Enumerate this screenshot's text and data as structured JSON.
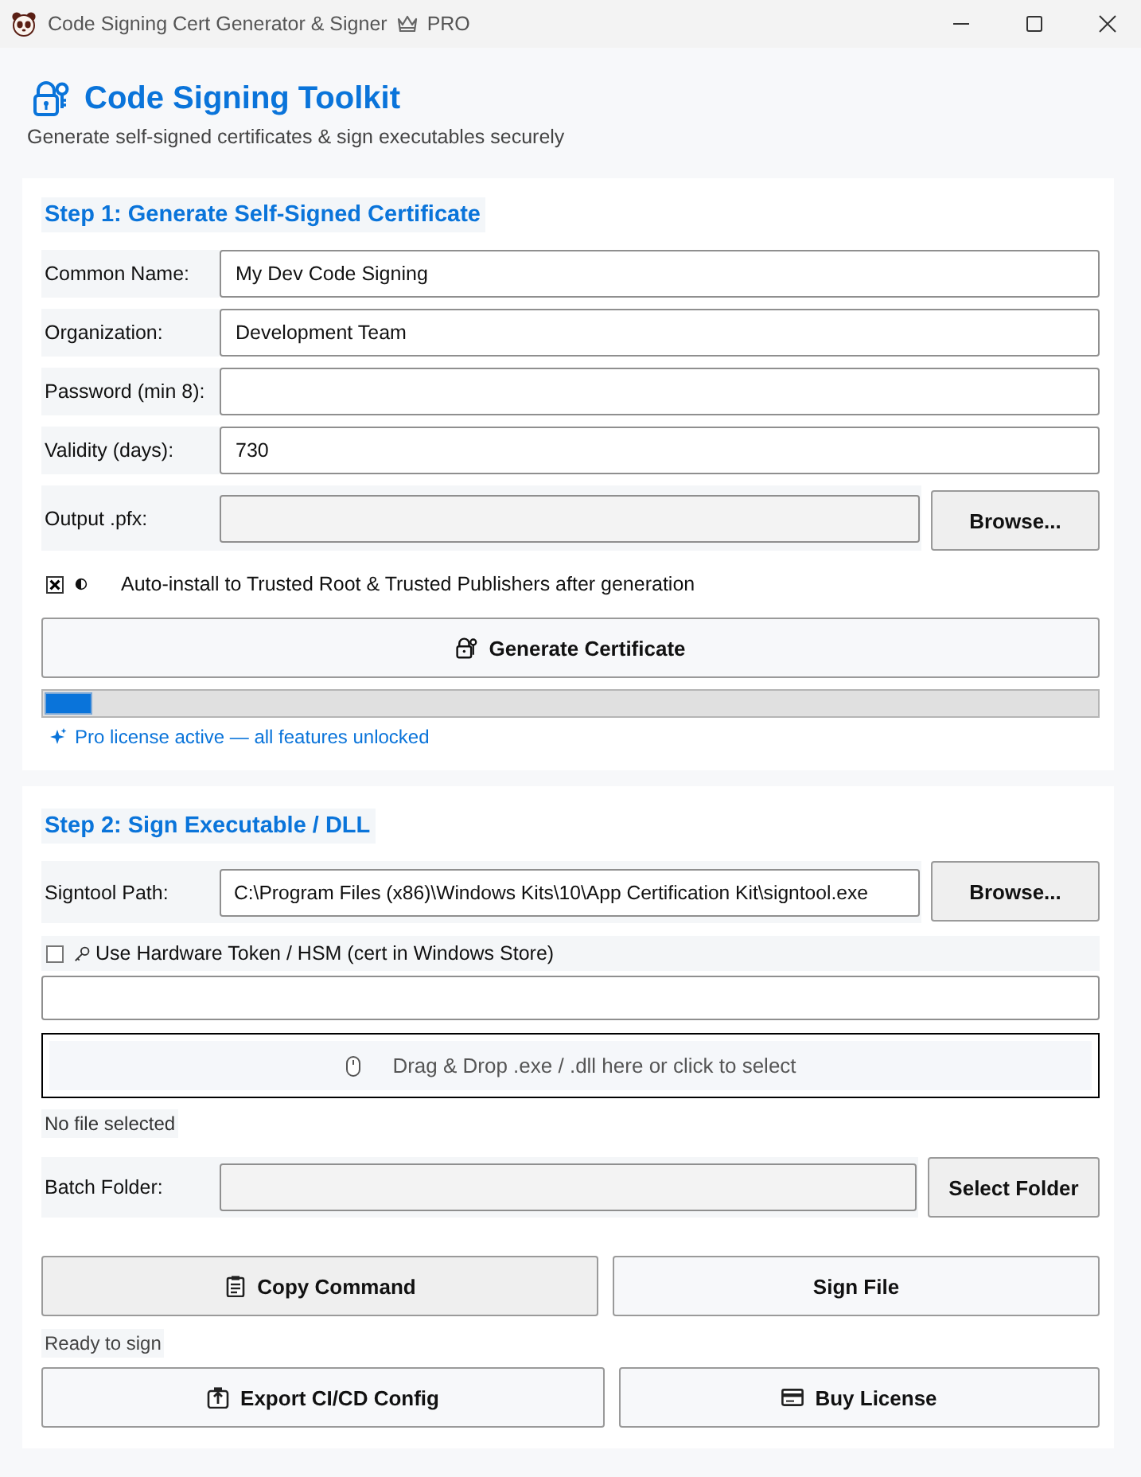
{
  "window": {
    "title": "Code Signing Cert Generator & Signer",
    "badge": "PRO"
  },
  "header": {
    "title": "Code Signing Toolkit",
    "subtitle": "Generate self-signed certificates & sign executables securely"
  },
  "step1": {
    "heading": "Step 1: Generate Self-Signed Certificate",
    "fields": [
      {
        "label": "Common Name:",
        "value": "My Dev Code Signing"
      },
      {
        "label": "Organization:",
        "value": "Development Team"
      },
      {
        "label": "Password (min 8):"
      },
      {
        "label": "Validity (days):",
        "value": "730"
      }
    ],
    "output": {
      "label": "Output .pfx:",
      "button": "Browse..."
    },
    "auto_install": {
      "checked": true,
      "label": "Auto-install to Trusted Root & Trusted Publishers after generation"
    },
    "generate_button": "Generate Certificate",
    "progress": {
      "level": 0.045
    },
    "license_status": "Pro license active — all features unlocked"
  },
  "step2": {
    "heading": "Step 2: Sign Executable / DLL",
    "signtool": {
      "label": "Signtool Path:",
      "value": "C:\\Program Files (x86)\\Windows Kits\\10\\App Certification Kit\\signtool.exe",
      "button": "Browse..."
    },
    "hardware_token": {
      "checked": false,
      "label": "Use Hardware Token / HSM (cert in Windows Store)"
    },
    "drop_zone": {
      "text": "Drag & Drop .exe / .dll here or click to select"
    },
    "file_status": "No file selected",
    "batch": {
      "label": "Batch Folder:",
      "button": "Select Folder"
    },
    "actions": [
      {
        "label": "Copy Command",
        "kind": "secondary"
      },
      {
        "label": "Sign File",
        "kind": "primary"
      }
    ],
    "status": "Ready to sign",
    "more_actions": [
      {
        "label": "Export CI/CD Config",
        "kind": "primary"
      },
      {
        "label": "Buy License",
        "kind": "primary"
      }
    ]
  }
}
